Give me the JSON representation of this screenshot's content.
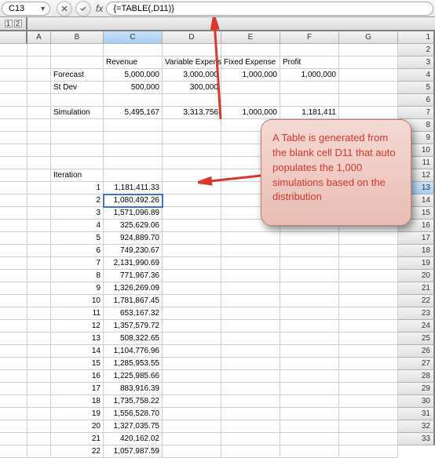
{
  "nameBox": "C13",
  "formula": "{=TABLE(,D11)}",
  "outline": [
    "1",
    "2"
  ],
  "colHeaders": [
    "",
    "A",
    "B",
    "C",
    "D",
    "E",
    "F",
    "G"
  ],
  "rows": [
    {
      "n": "1",
      "cells": [
        "",
        "",
        "",
        "",
        "",
        "",
        "",
        ""
      ]
    },
    {
      "n": "2",
      "cells": [
        "",
        "",
        "",
        "Revenue",
        "Variable Expense",
        "Fixed Expense",
        "Profit",
        ""
      ],
      "align": [
        "",
        "",
        "",
        "l",
        "l",
        "l",
        "l",
        ""
      ]
    },
    {
      "n": "3",
      "cells": [
        "",
        "",
        "Forecast",
        "5,000,000",
        "3,000,000",
        "1,000,000",
        "1,000,000",
        ""
      ],
      "align": [
        "",
        "",
        "l",
        "r",
        "r",
        "r",
        "r",
        ""
      ]
    },
    {
      "n": "4",
      "cells": [
        "",
        "",
        "St Dev",
        "500,000",
        "300,000",
        "",
        "",
        ""
      ],
      "align": [
        "",
        "",
        "l",
        "r",
        "r",
        "",
        "",
        ""
      ]
    },
    {
      "n": "5",
      "cells": [
        "",
        "",
        "",
        "",
        "",
        "",
        "",
        ""
      ]
    },
    {
      "n": "6",
      "cells": [
        "",
        "",
        "Simulation",
        "5,495,167",
        "3,313,756",
        "1,000,000",
        "1,181,411",
        ""
      ],
      "align": [
        "",
        "",
        "l",
        "r",
        "r",
        "r",
        "r",
        ""
      ]
    },
    {
      "n": "7",
      "cells": [
        "",
        "",
        "",
        "",
        "",
        "",
        "",
        ""
      ]
    },
    {
      "n": "8",
      "cells": [
        "",
        "",
        "",
        "",
        "",
        "",
        "",
        ""
      ]
    },
    {
      "n": "9",
      "cells": [
        "",
        "",
        "",
        "",
        "",
        "",
        "",
        ""
      ]
    },
    {
      "n": "10",
      "cells": [
        "",
        "",
        "",
        "",
        "",
        "",
        "",
        ""
      ]
    },
    {
      "n": "11",
      "cells": [
        "",
        "",
        "Iteration",
        "",
        "",
        "",
        "",
        ""
      ],
      "align": [
        "",
        "",
        "l",
        "",
        "",
        "",
        "",
        ""
      ]
    },
    {
      "n": "12",
      "cells": [
        "",
        "",
        "1",
        "1,181,411.33",
        "",
        "",
        "",
        ""
      ],
      "align": [
        "",
        "",
        "r",
        "r",
        "",
        "",
        "",
        ""
      ]
    },
    {
      "n": "13",
      "cells": [
        "",
        "",
        "2",
        "1,080,492.26",
        "",
        "",
        "",
        ""
      ],
      "align": [
        "",
        "",
        "r",
        "r",
        "",
        "",
        "",
        ""
      ],
      "selCol": 3
    },
    {
      "n": "14",
      "cells": [
        "",
        "",
        "3",
        "1,571,096.89",
        "",
        "",
        "",
        ""
      ],
      "align": [
        "",
        "",
        "r",
        "r",
        "",
        "",
        "",
        ""
      ]
    },
    {
      "n": "15",
      "cells": [
        "",
        "",
        "4",
        "325,629.06",
        "",
        "",
        "",
        ""
      ],
      "align": [
        "",
        "",
        "r",
        "r",
        "",
        "",
        "",
        ""
      ]
    },
    {
      "n": "16",
      "cells": [
        "",
        "",
        "5",
        "924,889.70",
        "",
        "",
        "",
        ""
      ],
      "align": [
        "",
        "",
        "r",
        "r",
        "",
        "",
        "",
        ""
      ]
    },
    {
      "n": "17",
      "cells": [
        "",
        "",
        "6",
        "749,230.67",
        "",
        "",
        "",
        ""
      ],
      "align": [
        "",
        "",
        "r",
        "r",
        "",
        "",
        "",
        ""
      ]
    },
    {
      "n": "18",
      "cells": [
        "",
        "",
        "7",
        "2,131,990.69",
        "",
        "",
        "",
        ""
      ],
      "align": [
        "",
        "",
        "r",
        "r",
        "",
        "",
        "",
        ""
      ]
    },
    {
      "n": "19",
      "cells": [
        "",
        "",
        "8",
        "771,967.36",
        "",
        "",
        "",
        ""
      ],
      "align": [
        "",
        "",
        "r",
        "r",
        "",
        "",
        "",
        ""
      ]
    },
    {
      "n": "20",
      "cells": [
        "",
        "",
        "9",
        "1,326,269.09",
        "",
        "",
        "",
        ""
      ],
      "align": [
        "",
        "",
        "r",
        "r",
        "",
        "",
        "",
        ""
      ]
    },
    {
      "n": "21",
      "cells": [
        "",
        "",
        "10",
        "1,781,867.45",
        "",
        "",
        "",
        ""
      ],
      "align": [
        "",
        "",
        "r",
        "r",
        "",
        "",
        "",
        ""
      ]
    },
    {
      "n": "22",
      "cells": [
        "",
        "",
        "11",
        "653,167.32",
        "",
        "",
        "",
        ""
      ],
      "align": [
        "",
        "",
        "r",
        "r",
        "",
        "",
        "",
        ""
      ]
    },
    {
      "n": "23",
      "cells": [
        "",
        "",
        "12",
        "1,357,579.72",
        "",
        "",
        "",
        ""
      ],
      "align": [
        "",
        "",
        "r",
        "r",
        "",
        "",
        "",
        ""
      ]
    },
    {
      "n": "24",
      "cells": [
        "",
        "",
        "13",
        "508,322.65",
        "",
        "",
        "",
        ""
      ],
      "align": [
        "",
        "",
        "r",
        "r",
        "",
        "",
        "",
        ""
      ]
    },
    {
      "n": "25",
      "cells": [
        "",
        "",
        "14",
        "1,104,776.96",
        "",
        "",
        "",
        ""
      ],
      "align": [
        "",
        "",
        "r",
        "r",
        "",
        "",
        "",
        ""
      ]
    },
    {
      "n": "26",
      "cells": [
        "",
        "",
        "15",
        "1,285,953.55",
        "",
        "",
        "",
        ""
      ],
      "align": [
        "",
        "",
        "r",
        "r",
        "",
        "",
        "",
        ""
      ]
    },
    {
      "n": "27",
      "cells": [
        "",
        "",
        "16",
        "1,225,985.66",
        "",
        "",
        "",
        ""
      ],
      "align": [
        "",
        "",
        "r",
        "r",
        "",
        "",
        "",
        ""
      ]
    },
    {
      "n": "28",
      "cells": [
        "",
        "",
        "17",
        "883,916.39",
        "",
        "",
        "",
        ""
      ],
      "align": [
        "",
        "",
        "r",
        "r",
        "",
        "",
        "",
        ""
      ]
    },
    {
      "n": "29",
      "cells": [
        "",
        "",
        "18",
        "1,735,758.22",
        "",
        "",
        "",
        ""
      ],
      "align": [
        "",
        "",
        "r",
        "r",
        "",
        "",
        "",
        ""
      ]
    },
    {
      "n": "30",
      "cells": [
        "",
        "",
        "19",
        "1,556,528.70",
        "",
        "",
        "",
        ""
      ],
      "align": [
        "",
        "",
        "r",
        "r",
        "",
        "",
        "",
        ""
      ]
    },
    {
      "n": "31",
      "cells": [
        "",
        "",
        "20",
        "1,327,035.75",
        "",
        "",
        "",
        ""
      ],
      "align": [
        "",
        "",
        "r",
        "r",
        "",
        "",
        "",
        ""
      ]
    },
    {
      "n": "32",
      "cells": [
        "",
        "",
        "21",
        "420,162.02",
        "",
        "",
        "",
        ""
      ],
      "align": [
        "",
        "",
        "r",
        "r",
        "",
        "",
        "",
        ""
      ]
    },
    {
      "n": "33",
      "cells": [
        "",
        "",
        "22",
        "1,057,987.59",
        "",
        "",
        "",
        ""
      ],
      "align": [
        "",
        "",
        "r",
        "r",
        "",
        "",
        "",
        ""
      ]
    }
  ],
  "callout": "A Table is generated from the blank cell D11 that auto populates the 1,000 simulations based on the distribution",
  "selectedRow": "13",
  "selectedCol": "C"
}
